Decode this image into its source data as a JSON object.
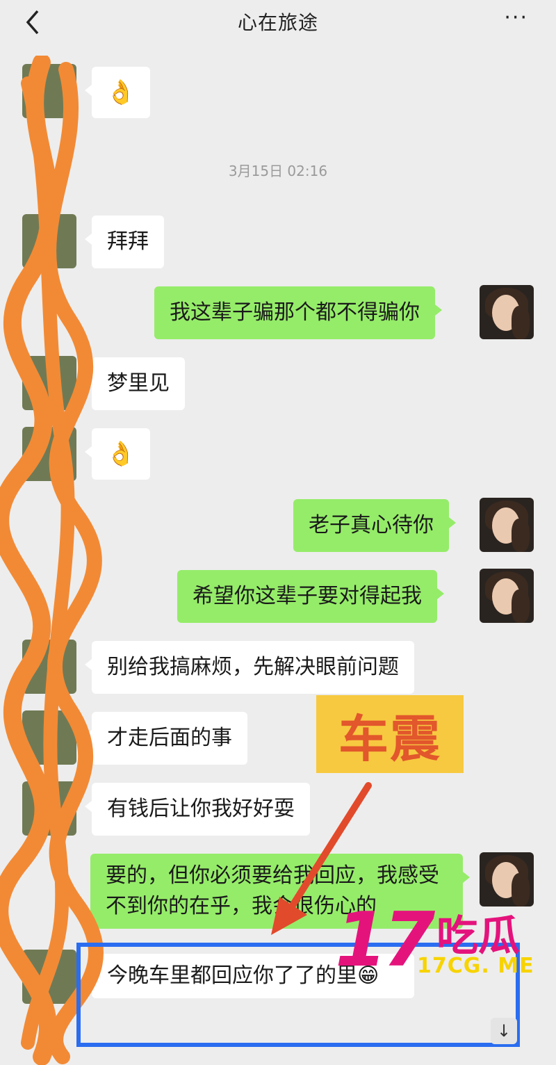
{
  "header": {
    "title": "心在旅途",
    "more": "···"
  },
  "messages": [
    {
      "side": "left",
      "text": "👌"
    },
    {
      "side": "left",
      "text": "拜拜"
    },
    {
      "side": "right",
      "text": "我这辈子骗那个都不得骗你"
    },
    {
      "side": "left",
      "text": "梦里见"
    },
    {
      "side": "left",
      "text": "👌"
    },
    {
      "side": "right",
      "text": "老子真心待你"
    },
    {
      "side": "right",
      "text": "希望你这辈子要对得起我"
    },
    {
      "side": "left",
      "text": "别给我搞麻烦，先解决眼前问题"
    },
    {
      "side": "left",
      "text": "才走后面的事"
    },
    {
      "side": "left",
      "text": "有钱后让你我好好耍"
    },
    {
      "side": "right",
      "text": "要的，但你必须要给我回应，我感受不到你的在乎，我会很伤心的"
    },
    {
      "side": "left",
      "text": "今晚车里都回应你了了的里😁"
    }
  ],
  "timestamp": "3月15日 02:16",
  "annotation": {
    "label": "车震",
    "label_bg": "#f7c940",
    "label_color": "#e2572c",
    "box_color": "#2a6df0"
  },
  "watermark": {
    "number": "17",
    "brand": "吃瓜",
    "url": "17CG. ME",
    "color": "#e4137c"
  },
  "scroll_icon": "↓",
  "colors": {
    "background": "#ededed",
    "bubble_self": "#95ec69",
    "bubble_other": "#ffffff",
    "scribble": "#f28a35"
  }
}
